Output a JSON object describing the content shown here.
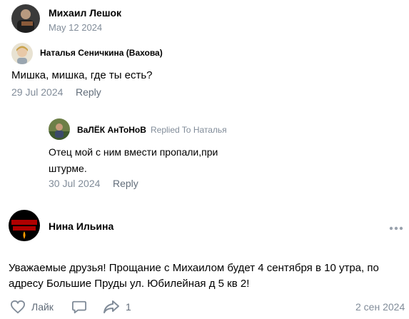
{
  "post_author": {
    "name": "Михаил Лешок",
    "date": "May 12 2024"
  },
  "comment": {
    "author": "Наталья Сеничкина (Вахова)",
    "text": "Мишка, мишка, где ты есть?",
    "date": "29 Jul 2024",
    "reply_label": "Reply"
  },
  "reply_comment": {
    "author": "ВаЛЁК АнТоНоВ",
    "replied_to": "Replied To Наталья",
    "text_line1": "Отец мой с ним вмести пропали,при",
    "text_line2": "штурме.",
    "date": "30 Jul 2024",
    "reply_label": "Reply"
  },
  "post": {
    "author": "Нина Ильина",
    "avatar_text": "Вечная память Браташка",
    "text_line1": "Уважаемые друзья! Прощание с Михаилом будет 4 сентября в 10 утра, по",
    "text_line2": "адресу Большие Пруды ул. Юбилейная д 5 кв 2!",
    "like_label": "Лайк",
    "share_count": "1",
    "date": "2 сен 2024"
  },
  "icons": {
    "more": "more-dots-icon",
    "like": "heart-icon",
    "comment": "comment-icon",
    "share": "share-icon"
  }
}
